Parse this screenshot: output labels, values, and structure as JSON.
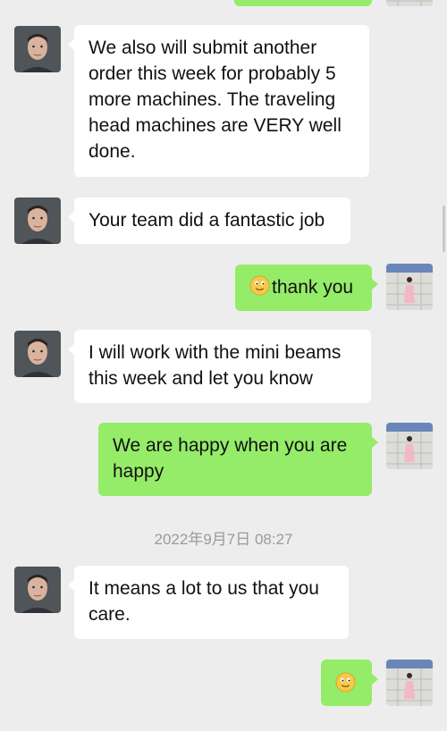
{
  "chat": {
    "messages": [
      {
        "sender": "contact",
        "text": "We also will submit another order this week for probably 5 more machines. The traveling head machines are VERY well done."
      },
      {
        "sender": "contact",
        "text": "Your team did a fantastic job"
      },
      {
        "sender": "me",
        "emoji": "slightly-smiling-face-icon",
        "text": "thank you"
      },
      {
        "sender": "contact",
        "text": "I will work with the mini beams this week and let you know"
      },
      {
        "sender": "me",
        "text": "We are happy when you are happy"
      },
      {
        "sender": "contact",
        "text": "It means a lot to us that you care."
      },
      {
        "sender": "me",
        "emoji": "slightly-smiling-face-icon",
        "text": ""
      }
    ],
    "timestamp": "2022年9月7日 08:27"
  },
  "colors": {
    "background": "#ededed",
    "incoming_bubble": "#ffffff",
    "outgoing_bubble": "#95ec69",
    "timestamp_text": "#9b9b9b"
  }
}
